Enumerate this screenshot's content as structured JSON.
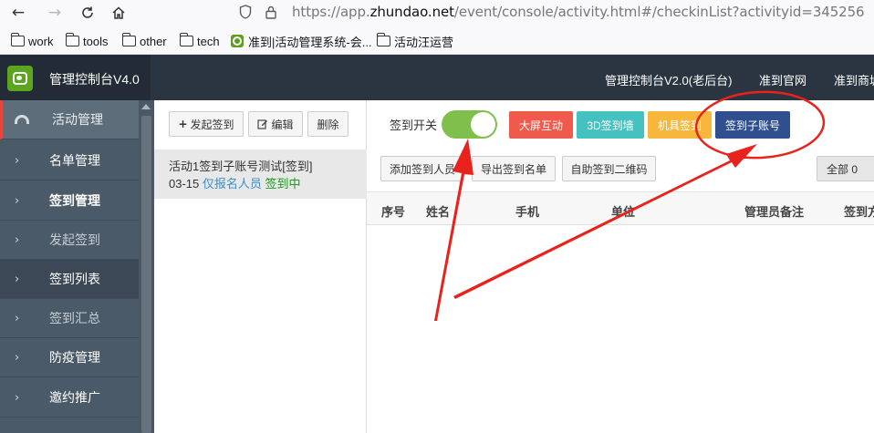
{
  "browser": {
    "url_scheme": "https://app.",
    "url_host": "zhundao.net",
    "url_path": "/event/console/activity.html#/checkinList?activityid=345256",
    "bookmarks": [
      "work",
      "tools",
      "other",
      "tech",
      "准到|活动管理系统-会...",
      "活动汪运营"
    ]
  },
  "header": {
    "app_title": "管理控制台V4.0",
    "links": [
      "管理控制台V2.0(老后台)",
      "准到官网",
      "准到商城"
    ]
  },
  "sidebar": {
    "items": [
      {
        "label": "活动管理"
      },
      {
        "label": "名单管理"
      },
      {
        "label": "签到管理"
      },
      {
        "label": "发起签到"
      },
      {
        "label": "签到列表"
      },
      {
        "label": "签到汇总"
      },
      {
        "label": "防疫管理"
      },
      {
        "label": "邀约推广"
      }
    ]
  },
  "list_panel": {
    "toolbar": {
      "new_label": "发起签到",
      "edit_label": "编辑",
      "delete_label": "删除"
    },
    "activity": {
      "title": "活动1签到子账号测试[签到]",
      "date": "03-15",
      "registrant_scope": "仅报名人员",
      "status": "签到中"
    }
  },
  "content": {
    "switch_label": "签到开关",
    "switch_on": true,
    "buttons": [
      {
        "label": "大屏互动",
        "color": "#f05a4c"
      },
      {
        "label": "3D签到墙",
        "color": "#45c2c0"
      },
      {
        "label": "机具签到",
        "color": "#f6b73c"
      },
      {
        "label": "签到子账号",
        "color": "#2f4f8f"
      }
    ],
    "sub_buttons": [
      "添加签到人员",
      "导出签到名单",
      "自助签到二维码"
    ],
    "filter_label": "全部 0",
    "table_headers": [
      "序号",
      "姓名",
      "手机",
      "单位",
      "管理员备注",
      "签到方式"
    ]
  },
  "colors": {
    "sidebar_bg": "#4b5a68",
    "header_bg": "#2b3541",
    "annotation": "#e8221c"
  }
}
